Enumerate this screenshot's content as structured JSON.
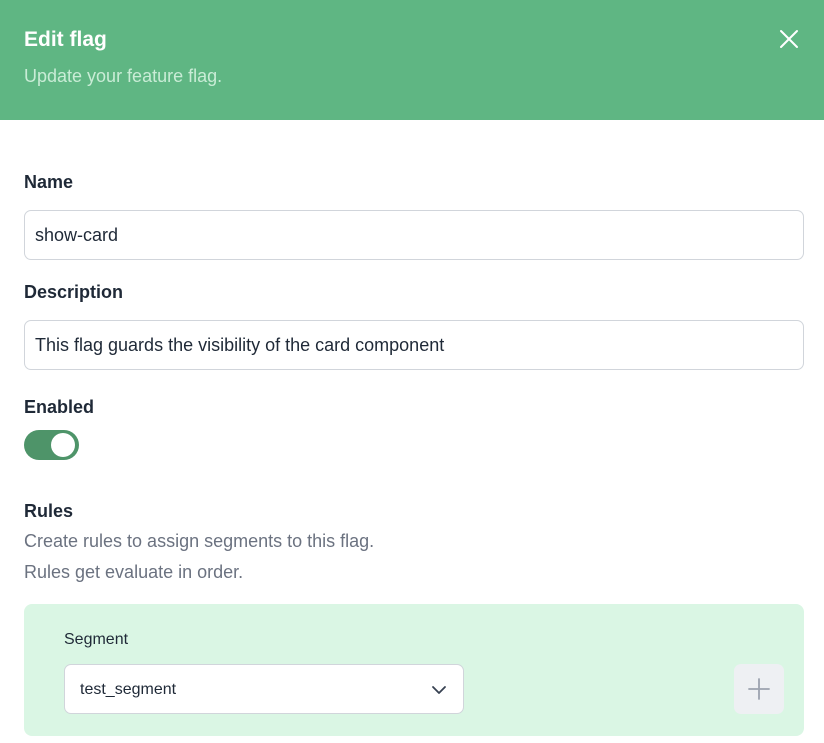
{
  "header": {
    "title": "Edit flag",
    "subtitle": "Update your feature flag.",
    "close_icon": "close-icon"
  },
  "form": {
    "name": {
      "label": "Name",
      "value": "show-card"
    },
    "description": {
      "label": "Description",
      "value": "This flag guards the visibility of the card component"
    },
    "enabled": {
      "label": "Enabled",
      "value": true
    },
    "rules": {
      "label": "Rules",
      "help_line_1": "Create rules to assign segments to this flag.",
      "help_line_2": "Rules get evaluate in order.",
      "items": [
        {
          "segment_label": "Segment",
          "segment_value": "test_segment"
        }
      ],
      "add_icon": "plus-icon"
    }
  },
  "colors": {
    "header_bg": "#5fb683",
    "toggle_on": "#4e9469",
    "rule_bg": "#daf6e4"
  }
}
